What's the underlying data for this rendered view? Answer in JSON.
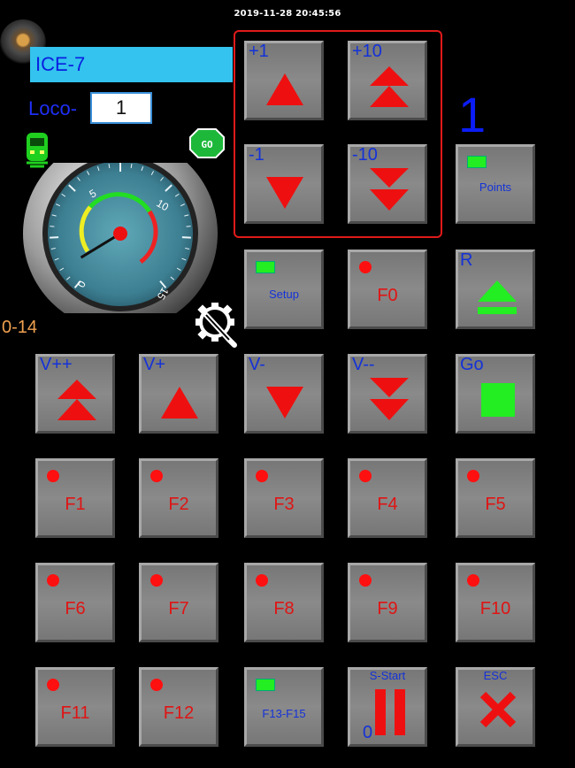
{
  "timestamp": "2019-11-28 20:45:56",
  "loco_name": "ICE-7",
  "loco_label": "Loco-",
  "loco_number": "1",
  "speed_display": "1",
  "speed_range": "0-14",
  "go_badge": "GO",
  "gauge": {
    "ticks": [
      "0",
      "5",
      "10",
      "15"
    ],
    "max": 15,
    "needle_value": 1
  },
  "speed_steps": [
    {
      "label": "+1",
      "icon": "up-arrow-icon"
    },
    {
      "label": "+10",
      "icon": "double-up-arrow-icon"
    },
    {
      "label": "-1",
      "icon": "down-arrow-icon"
    },
    {
      "label": "-10",
      "icon": "double-down-arrow-icon"
    }
  ],
  "points_button": "Points",
  "setup_button": "Setup",
  "f0_button": "F0",
  "reverse_button": "R",
  "velocity_buttons": [
    {
      "label": "V++",
      "icon": "double-up-arrow-icon"
    },
    {
      "label": "V+",
      "icon": "up-arrow-icon"
    },
    {
      "label": "V-",
      "icon": "down-arrow-icon"
    },
    {
      "label": "V--",
      "icon": "double-down-arrow-icon"
    }
  ],
  "go_button": "Go",
  "function_buttons": [
    "F1",
    "F2",
    "F3",
    "F4",
    "F5",
    "F6",
    "F7",
    "F8",
    "F9",
    "F10",
    "F11",
    "F12"
  ],
  "f13_button": "F13-F15",
  "sstart_button": {
    "label": "S-Start",
    "counter": "0"
  },
  "esc_button": "ESC",
  "colors": {
    "arrow_red": "#ee1010",
    "label_blue": "#1432d8",
    "function_red": "#e01414",
    "led_green": "#22ee22"
  }
}
